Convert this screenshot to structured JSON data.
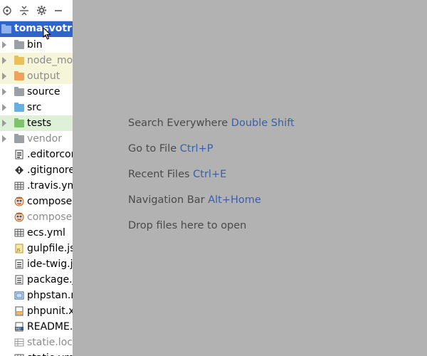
{
  "project": {
    "name": "tomasvotruba"
  },
  "tree": [
    {
      "label": "bin",
      "kind": "folder",
      "color": "#9aa0a6"
    },
    {
      "label": "node_modules",
      "kind": "folder",
      "color": "#e8c15b",
      "muted": true,
      "highlight": "yellow"
    },
    {
      "label": "output",
      "kind": "folder",
      "color": "#f0a15a",
      "muted": true,
      "highlight": "yellow"
    },
    {
      "label": "source",
      "kind": "folder",
      "color": "#9aa0a6"
    },
    {
      "label": "src",
      "kind": "folder",
      "color": "#6ab0de"
    },
    {
      "label": "tests",
      "kind": "folder",
      "color": "#7cc36a",
      "highlight": "green"
    },
    {
      "label": "vendor",
      "kind": "folder",
      "color": "#9aa0a6",
      "muted": true
    },
    {
      "label": ".editorconfig",
      "kind": "file",
      "icon": "editorconfig-icon"
    },
    {
      "label": ".gitignore",
      "kind": "file",
      "icon": "git-icon"
    },
    {
      "label": ".travis.yml",
      "kind": "file",
      "icon": "table-icon"
    },
    {
      "label": "composer.json",
      "kind": "file",
      "icon": "composer-icon"
    },
    {
      "label": "composer.lock",
      "kind": "file",
      "icon": "composer-icon",
      "muted": true
    },
    {
      "label": "ecs.yml",
      "kind": "file",
      "icon": "table-icon"
    },
    {
      "label": "gulpfile.js",
      "kind": "file",
      "icon": "js-icon"
    },
    {
      "label": "ide-twig.json",
      "kind": "file",
      "icon": "json-icon"
    },
    {
      "label": "package.json",
      "kind": "file",
      "icon": "json-icon"
    },
    {
      "label": "phpstan.neon",
      "kind": "file",
      "icon": "neon-icon"
    },
    {
      "label": "phpunit.xml",
      "kind": "file",
      "icon": "xml-icon"
    },
    {
      "label": "README.md",
      "kind": "file",
      "icon": "md-icon"
    },
    {
      "label": "statie.lock",
      "kind": "file",
      "icon": "lock-icon",
      "muted": true
    },
    {
      "label": "statie.yml",
      "kind": "file",
      "icon": "table-icon"
    }
  ],
  "hints": [
    {
      "text": "Search Everywhere",
      "key": "Double Shift"
    },
    {
      "text": "Go to File",
      "key": "Ctrl+P"
    },
    {
      "text": "Recent Files",
      "key": "Ctrl+E"
    },
    {
      "text": "Navigation Bar",
      "key": "Alt+Home"
    },
    {
      "text": "Drop files here to open",
      "key": ""
    }
  ]
}
